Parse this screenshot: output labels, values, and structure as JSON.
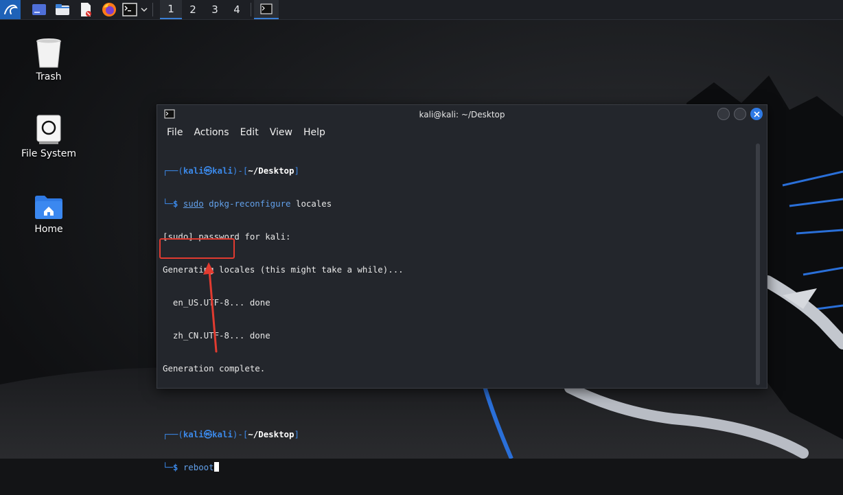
{
  "panel": {
    "workspaces": [
      "1",
      "2",
      "3",
      "4"
    ],
    "active_workspace": "1"
  },
  "desktop_icons": [
    {
      "label": "Trash",
      "icon": "trash-icon"
    },
    {
      "label": "File System",
      "icon": "drive-icon"
    },
    {
      "label": "Home",
      "icon": "home-folder-icon"
    }
  ],
  "terminal": {
    "title": "kali@kali: ~/Desktop",
    "menu": [
      "File",
      "Actions",
      "Edit",
      "View",
      "Help"
    ],
    "prompt1": {
      "user": "kali",
      "host": "kali",
      "dir": "~/Desktop",
      "cmd_sudo": "sudo",
      "cmd_rest": "dpkg-reconfigure",
      "cmd_arg": "locales"
    },
    "output": [
      "[sudo] password for kali:",
      "Generating locales (this might take a while)...",
      "  en_US.UTF-8... done",
      "  zh_CN.UTF-8... done",
      "Generation complete."
    ],
    "prompt2": {
      "user": "kali",
      "host": "kali",
      "dir": "~/Desktop",
      "cmd": "reboot"
    }
  },
  "colors": {
    "accent": "#2f7ae5",
    "prompt_blue": "#3b88e8",
    "annotation_red": "#e23b30"
  }
}
